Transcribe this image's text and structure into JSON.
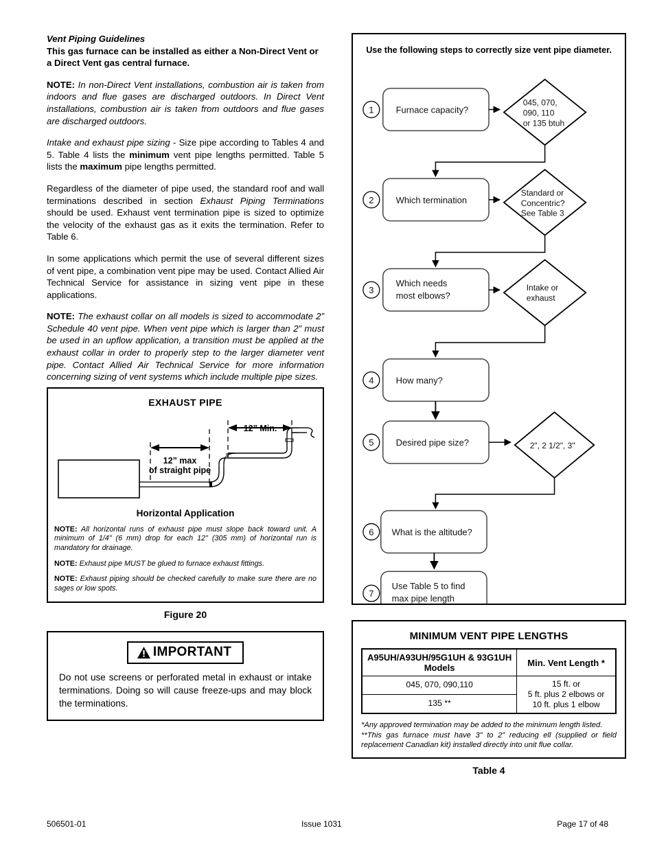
{
  "left": {
    "section_heading": "Vent Piping Guidelines",
    "intro_bold": "This gas furnace can be installed as either a Non-Direct Vent or a Direct Vent gas central furnace.",
    "note1_label": "NOTE:",
    "note1_text": "In non-Direct Vent installations, combustion air is taken from indoors and flue gases are discharged outdoors. In Direct Vent installations, combustion air is taken from outdoors and flue gases are discharged outdoors.",
    "para2_italic": "Intake and exhaust pipe sizing",
    "para2_a": " - Size pipe according to Tables 4 and 5.  Table 4 lists the ",
    "para2_bold1": "minimum",
    "para2_b": " vent pipe lengths permitted.  Table 5 lists the ",
    "para2_bold2": "maximum",
    "para2_c": " pipe lengths permitted.",
    "para3_a": "Regardless of the diameter of pipe used, the standard roof and wall terminations described in section ",
    "para3_italic": "Exhaust Piping Terminations",
    "para3_b": " should be used.  Exhaust vent termination pipe is sized to optimize the velocity of the exhaust gas as it exits the termination.  Refer to Table 6.",
    "para4": "In some applications which permit the use of several different sizes of vent pipe, a combination vent pipe may be used. Contact Allied Air Technical Service for assistance in sizing vent pipe in these applications.",
    "note2_label": "NOTE:",
    "note2_text": "The exhaust collar on all models is sized to accommodate 2” Schedule 40 vent pipe.  When vent pipe which is larger than 2” must be used in an upflow application, a transition must be applied at the exhaust collar in order to properly step to the larger diameter vent pipe.  Contact Allied Air Technical Service for more information concerning sizing of vent systems which include multiple pipe sizes."
  },
  "figure20": {
    "title": "EXHAUST PIPE",
    "subtitle": "Horizontal Application",
    "dim_max_line1": "12” max",
    "dim_max_line2": "of straight pipe",
    "dim_min": "12” Min.",
    "notes": [
      {
        "label": "NOTE:",
        "text": "All horizontal runs of exhaust pipe must slope back toward unit.  A minimum of 1/4\" (6 mm) drop for each 12\" (305 mm) of horizontal run is mandatory for drainage."
      },
      {
        "label": "NOTE:",
        "text": "Exhaust pipe MUST be glued to furnace exhaust fittings."
      },
      {
        "label": "NOTE:",
        "text": "Exhaust piping should be checked carefully to make sure there are no sages or low spots."
      }
    ],
    "caption": "Figure 20"
  },
  "important": {
    "badge_label": "IMPORTANT",
    "body": "Do not use screens or perforated metal in exhaust or intake terminations.  Doing so will cause freeze-ups and may block the terminations."
  },
  "flowchart": {
    "title": "Use the following steps to correctly size vent pipe diameter.",
    "steps": [
      {
        "num": "1",
        "label": "Furnace capacity?"
      },
      {
        "num": "2",
        "label": "Which termination"
      },
      {
        "num": "3",
        "label_line1": "Which needs",
        "label_line2": "most elbows?"
      },
      {
        "num": "4",
        "label": "How many?"
      },
      {
        "num": "5",
        "label": "Desired pipe size?"
      },
      {
        "num": "6",
        "label": "What is the altitude?"
      },
      {
        "num": "7",
        "label_line1": "Use Table 5 to find",
        "label_line2": "max pipe length"
      }
    ],
    "decisions": [
      {
        "line1": "045, 070,",
        "line2": "090, 110",
        "line3": "or 135 btuh"
      },
      {
        "line1": "Standard or",
        "line2": "Concentric?",
        "line3": "See Table 3"
      },
      {
        "line1": "Intake or",
        "line2": "exhaust",
        "line3": ""
      },
      {
        "line1": "2\", 2 1/2\", 3\"",
        "line2": "",
        "line3": ""
      }
    ]
  },
  "table4": {
    "title": "MINIMUM VENT PIPE LENGTHS",
    "headers": [
      "A95UH/A93UH/95G1UH & 93G1UH Models",
      "Min. Vent Length *"
    ],
    "rows": [
      {
        "models": "045, 070, 090,110"
      },
      {
        "models": "135 **"
      }
    ],
    "vent_length": "15 ft. or\n5 ft. plus 2 elbows or\n10 ft. plus 1 elbow",
    "vent_length_lines": [
      "15 ft. or",
      "5 ft. plus 2 elbows or",
      "10 ft. plus 1 elbow"
    ],
    "footnote1": "*Any approved termination may be added to the minimum length listed.",
    "footnote2": "**This gas furnace must have 3\" to 2\" reducing ell (supplied or field replacement Canadian kit) installed directly into unit flue collar.",
    "caption": "Table 4"
  },
  "footer": {
    "left": "506501-01",
    "center": "Issue 1031",
    "right": "Page 17 of 48"
  }
}
